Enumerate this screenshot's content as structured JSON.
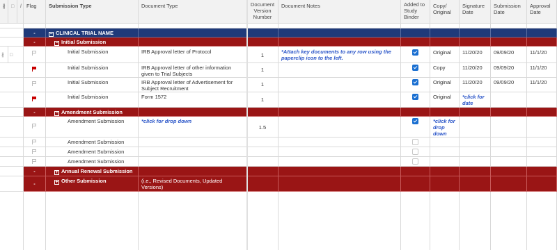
{
  "headers": {
    "flag": "Flag",
    "submission_type": "Submission Type",
    "document_type": "Document Type",
    "doc_version_number": "Document Version Number",
    "document_notes": "Document Notes",
    "added_to_binder": "Added to Study Binder",
    "copy_original": "Copy/ Original",
    "signature_date": "Signature Date",
    "submission_date": "Submission Date",
    "approval_date": "Approval Date"
  },
  "group_dash": "-",
  "groups": {
    "clinical": "CLINICAL TRIAL NAME",
    "initial": "Initial Submission",
    "amendment": "Amendment Submission",
    "renewal": "Annual Renewal Submission",
    "other": "Other Submission",
    "other_doc": "(i.e., Revised Documents, Updated Versions)"
  },
  "initial_rows": [
    {
      "type": "Initial Submission",
      "doc": "IRB Approval letter of Protocol",
      "version": "1",
      "notes": "*Attach key documents to any row using the paperclip icon to the left.",
      "binder": true,
      "copy": "Original",
      "sig": "11/20/20",
      "sub": "09/09/20",
      "appr": "11/1/20",
      "flag": "empty"
    },
    {
      "type": "Initial Submission",
      "doc": "IRB Approval letter of other information given to Trial Subjects",
      "version": "1",
      "notes": "",
      "binder": true,
      "copy": "Copy",
      "sig": "11/20/20",
      "sub": "09/09/20",
      "appr": "11/1/20",
      "flag": "red"
    },
    {
      "type": "Initial Submission",
      "doc": "IRB Approval letter of Advertisement for Subject Recruitment",
      "version": "1",
      "notes": "",
      "binder": true,
      "copy": "Original",
      "sig": "11/20/20",
      "sub": "09/09/20",
      "appr": "11/1/20",
      "flag": "empty"
    },
    {
      "type": "Initial Submission",
      "doc": "Form 1572",
      "version": "1",
      "notes": "",
      "binder": true,
      "copy": "Original",
      "sig": "*click for date",
      "sub": "",
      "appr": "",
      "flag": "red"
    }
  ],
  "amendment_rows": [
    {
      "type": "Amendment Submission",
      "doc": "*click for drop down",
      "version": "1.5",
      "binder": true,
      "copy": "*click for drop down"
    },
    {
      "type": "Amendment Submission",
      "binder": false
    },
    {
      "type": "Amendment Submission",
      "binder": false
    },
    {
      "type": "Amendment Submission",
      "binder": false
    }
  ]
}
